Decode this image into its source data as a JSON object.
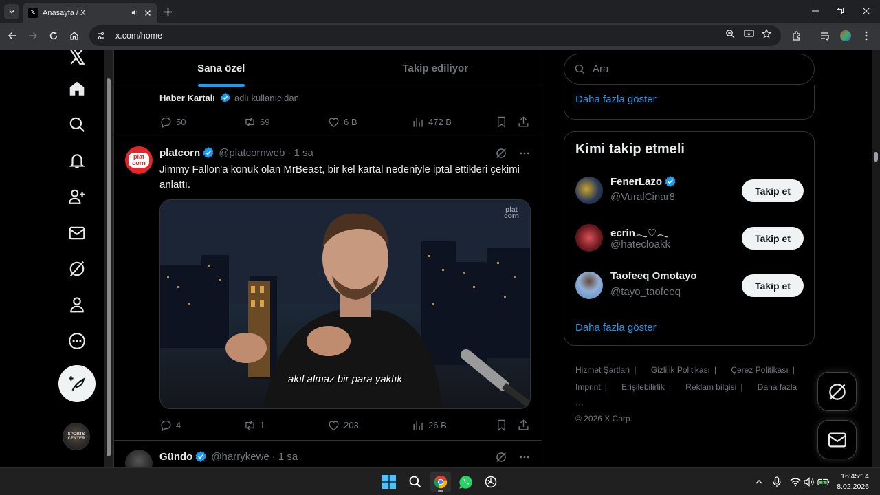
{
  "browser": {
    "tab_title": "Anasayfa / X",
    "url": "x.com/home"
  },
  "timeline": {
    "tabs": [
      {
        "label": "Sana özel",
        "active": true
      },
      {
        "label": "Takip ediliyor",
        "active": false
      }
    ],
    "prev_tweet": {
      "repost_by": "Haber Kartalı",
      "repost_suffix": "adlı kullanıcıdan",
      "replies": "50",
      "reposts": "69",
      "likes": "6 B",
      "views": "472 B"
    },
    "tweet": {
      "name": "platcorn",
      "handle": "@platcornweb",
      "time": "· 1 sa",
      "avatar_text": "plat corn",
      "text": "Jimmy Fallon'a konuk olan MrBeast, bir kel kartal nedeniyle iptal ettikleri çekimi anlattı.",
      "media_caption": "akıl almaz bir para yaktık",
      "watermark": "plat corn",
      "replies": "4",
      "reposts": "1",
      "likes": "203",
      "views": "26 B"
    },
    "next_tweet": {
      "name": "Gündo",
      "handle": "@harrykewe",
      "time": "· 1 sa"
    }
  },
  "sidebar": {
    "search_placeholder": "Ara",
    "show_more_top": "Daha fazla göster",
    "who_to_follow": {
      "title": "Kimi takip etmeli",
      "follow_label": "Takip et",
      "users": [
        {
          "name": "FenerLazo",
          "handle": "@VuralCinar8",
          "verified": true
        },
        {
          "name": "ecrin𓂃♡𓂃",
          "handle": "@hatecloakk",
          "verified": false
        },
        {
          "name": "Taofeeq Omotayo",
          "handle": "@tayo_taofeeq",
          "verified": false
        }
      ],
      "show_more": "Daha fazla göster"
    },
    "footer": {
      "links_row1": [
        "Hizmet Şartları",
        "Gizlilik Politikası",
        "Çerez Politikası"
      ],
      "links_row2": [
        "Imprint",
        "Erişilebilirlik",
        "Reklam bilgisi",
        "Daha fazla ···"
      ],
      "copyright": "© 2026 X Corp."
    }
  },
  "left_nav": {
    "account_avatar_text": "SPORTS CENTER"
  },
  "taskbar": {
    "time": "16:45:14",
    "date": "8.02.2026"
  },
  "colors": {
    "accent": "#1d9bf0",
    "background": "#000000",
    "border": "#2f3336",
    "muted": "#71767b"
  }
}
